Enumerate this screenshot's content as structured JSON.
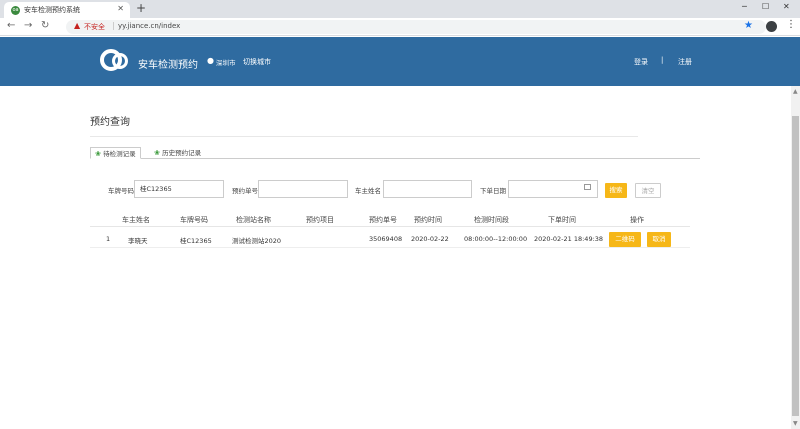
{
  "browser": {
    "tab_title": "安车检测预约系统",
    "tab_favicon": "oa",
    "insecure_label": "不安全",
    "url": "yy.jiance.cn/index"
  },
  "header": {
    "brand": "安车检测预约",
    "city": "深圳市",
    "switch_city": "切换城市",
    "login": "登录",
    "divider": "|",
    "register": "注册"
  },
  "page": {
    "title": "预约查询",
    "tabs": [
      {
        "label": "待检测记录",
        "active": true
      },
      {
        "label": "历史预约记录",
        "active": false
      }
    ]
  },
  "filters": {
    "plate_label": "车牌号码",
    "plate_value": "桂C12365",
    "order_label": "预约单号",
    "order_value": "",
    "owner_label": "车主姓名",
    "owner_value": "",
    "date_label": "下单日期",
    "date_value": "",
    "search_label": "搜索",
    "clear_label": "清空"
  },
  "table": {
    "columns": [
      "车主姓名",
      "车牌号码",
      "检测站名称",
      "预约项目",
      "预约单号",
      "预约时间",
      "检测时间段",
      "下单时间",
      "操作"
    ],
    "rows": [
      {
        "index": "1",
        "owner": "李晓天",
        "plate": "桂C12365",
        "station": "测试检测站2020",
        "item": "",
        "order_no": "35069408",
        "appt_date": "2020-02-22",
        "time_slot": "08:00:00--12:00:00",
        "order_time": "2020-02-21 18:49:38",
        "qr_label": "二维码",
        "cancel_label": "取消"
      }
    ]
  },
  "colors": {
    "header_bg": "#2f6ba0",
    "button_yellow": "#f6b718"
  }
}
